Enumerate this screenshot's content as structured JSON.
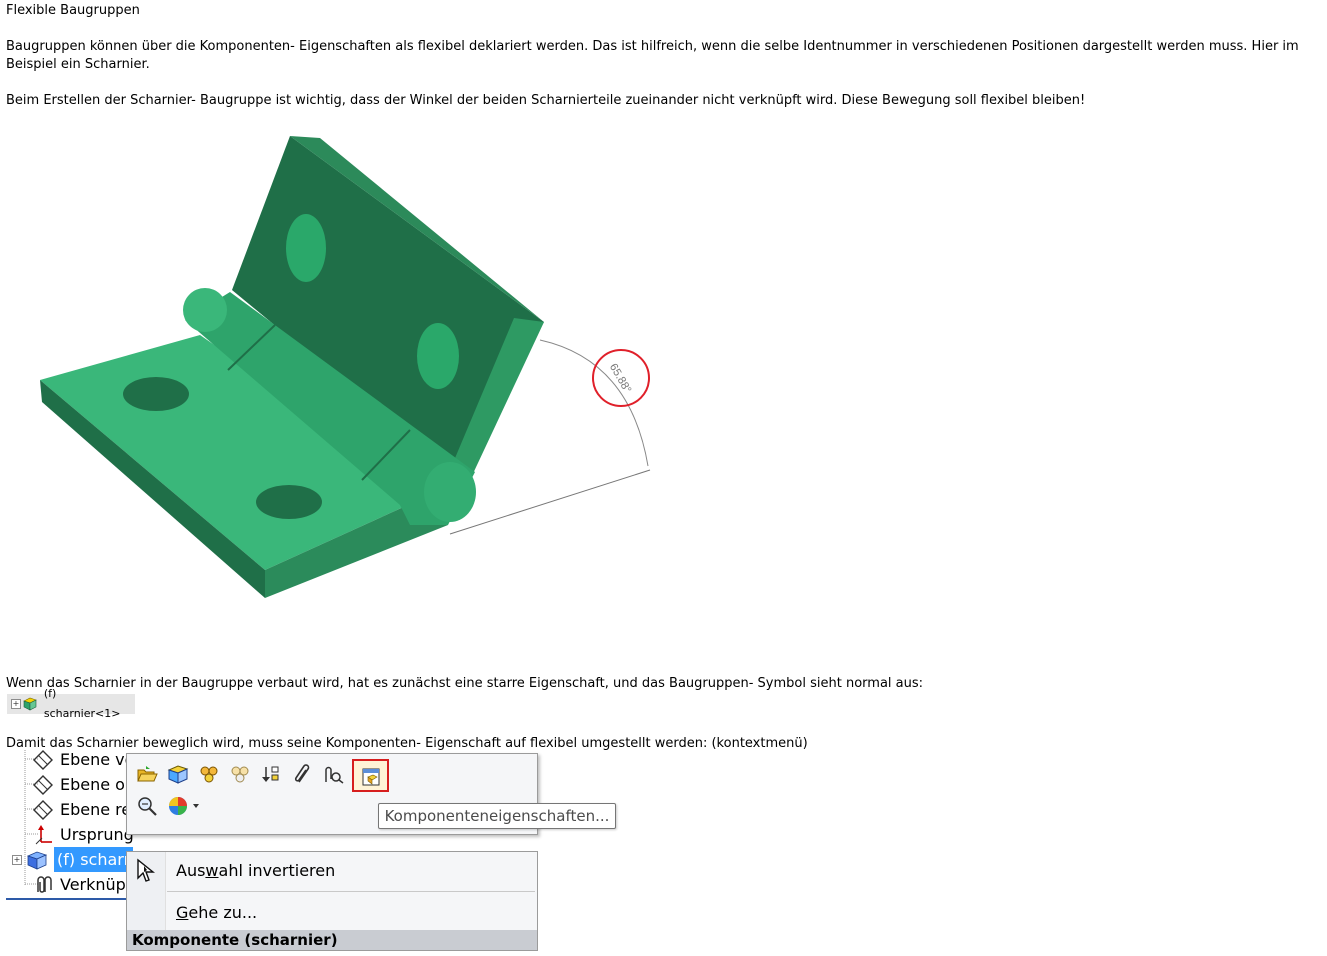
{
  "title": "Flexible Baugruppen",
  "paragraphs": {
    "intro": "Baugruppen können über die Komponenten- Eigenschaften als flexibel deklariert werden. Das ist hilfreich, wenn die selbe Identnummer in verschiedenen Positionen dargestellt werden muss. Hier im Beispiel ein Scharnier.",
    "assembly_note": "Beim Erstellen der Scharnier- Baugruppe ist wichtig, dass der Winkel der beiden Scharnierteile zueinander nicht verknüpft wird. Diese Bewegung soll flexibel bleiben!",
    "rigid_note": "Wenn das Scharnier in der Baugruppe verbaut wird, hat es zunächst eine starre Eigenschaft, und das Baugruppen- Symbol sieht normal aus:",
    "flexible_note": "Damit das Scharnier beweglich wird, muss seine Komponenten- Eigenschaft auf flexibel umgestellt werden: (kontextmenü)"
  },
  "hinge_model": {
    "angle_dimension": "65.88°",
    "color_main": "#3ab77a",
    "color_dark": "#1f6f48",
    "color_highlight": "#e0202a"
  },
  "tree_chip": {
    "label": "(f) scharnier<1>"
  },
  "feature_tree": {
    "rows": [
      "Ebene vo",
      "Ebene ob",
      "Ebene re",
      "Ursprung",
      "(f) scharr",
      "Verknüpf"
    ]
  },
  "context_menu": {
    "tooltip": "Komponenteneigenschaften...",
    "items": {
      "invert_pre": "Aus",
      "invert_ul": "w",
      "invert_post": "ahl invertieren",
      "goto_ul": "G",
      "goto_post": "ehe zu..."
    },
    "footer": "Komponente (scharnier)"
  }
}
